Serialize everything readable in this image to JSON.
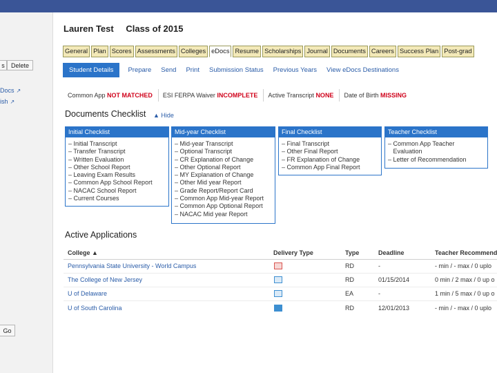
{
  "left_panel": {
    "btn_s": "s",
    "btn_delete": "Delete",
    "link_docs": "Docs",
    "link_ish": "ish",
    "btn_go": "Go"
  },
  "student": {
    "name": "Lauren Test",
    "class": "Class of 2015"
  },
  "tabs": [
    {
      "label": "General"
    },
    {
      "label": "Plan"
    },
    {
      "label": "Scores"
    },
    {
      "label": "Assessments"
    },
    {
      "label": "Colleges"
    },
    {
      "label": "eDocs"
    },
    {
      "label": "Resume"
    },
    {
      "label": "Scholarships"
    },
    {
      "label": "Journal"
    },
    {
      "label": "Documents"
    },
    {
      "label": "Careers"
    },
    {
      "label": "Success Plan"
    },
    {
      "label": "Post-grad"
    }
  ],
  "subnav": [
    {
      "label": "Student Details"
    },
    {
      "label": "Prepare"
    },
    {
      "label": "Send"
    },
    {
      "label": "Print"
    },
    {
      "label": "Submission Status"
    },
    {
      "label": "Previous Years"
    },
    {
      "label": "View eDocs Destinations"
    }
  ],
  "status": [
    {
      "label": "Common App ",
      "value": "NOT MATCHED"
    },
    {
      "label": "ESI FERPA Waiver ",
      "value": "INCOMPLETE"
    },
    {
      "label": "Active Transcript ",
      "value": "NONE"
    },
    {
      "label": "Date of Birth ",
      "value": "MISSING"
    }
  ],
  "documents": {
    "title": "Documents Checklist",
    "hide": "▲ Hide",
    "checklists": [
      {
        "title": "Initial Checklist",
        "items": [
          "– Initial Transcript",
          "– Transfer Transcript",
          "– Written Evaluation",
          "– Other School Report",
          "– Leaving Exam Results",
          "– Common App School Report",
          "– NACAC School Report",
          "– Current Courses"
        ]
      },
      {
        "title": "Mid-year Checklist",
        "items": [
          "– Mid-year Transcript",
          "– Optional Transcript",
          "– CR Explanation of Change",
          "– Other Optional Report",
          "– MY Explanation of Change",
          "– Other Mid year Report",
          "– Grade Report/Report Card",
          "– Common App Mid-year Report",
          "– Common App Optional Report",
          "– NACAC Mid year Report"
        ]
      },
      {
        "title": "Final Checklist",
        "items": [
          "– Final Transcript",
          "– Other Final Report",
          "– FR Explanation of Change",
          "– Common App Final Report"
        ]
      },
      {
        "title": "Teacher Checklist",
        "items": [
          "– Common App Teacher",
          "   Evaluation",
          "– Letter of Recommendation"
        ]
      }
    ]
  },
  "applications": {
    "title": "Active Applications",
    "headers": {
      "college": "College ▲",
      "delivery": "Delivery Type",
      "type": "Type",
      "deadline": "Deadline",
      "teacher": "Teacher Recommend"
    },
    "rows": [
      {
        "college": "Pennsylvania State University - World Campus",
        "delivery": "mail-icon",
        "type": "RD",
        "deadline": "-",
        "teacher": "- min / - max / 0 uplo"
      },
      {
        "college": "The College of New Jersey",
        "delivery": "screen-icon",
        "type": "RD",
        "deadline": "01/15/2014",
        "teacher": "0 min / 2 max / 0 up o"
      },
      {
        "college": "U of Delaware",
        "delivery": "screen-icon",
        "type": "EA",
        "deadline": "-",
        "teacher": "1 min / 5 max / 0 up o"
      },
      {
        "college": "U of South Carolina",
        "delivery": "screen-solid-icon",
        "type": "RD",
        "deadline": "12/01/2013",
        "teacher": "- min / - max / 0 uplo"
      }
    ]
  },
  "colors": {
    "topbar": "#3a5597",
    "accent": "#2b74c9",
    "tab": "#f3e9b8",
    "alert": "#d0021b"
  }
}
